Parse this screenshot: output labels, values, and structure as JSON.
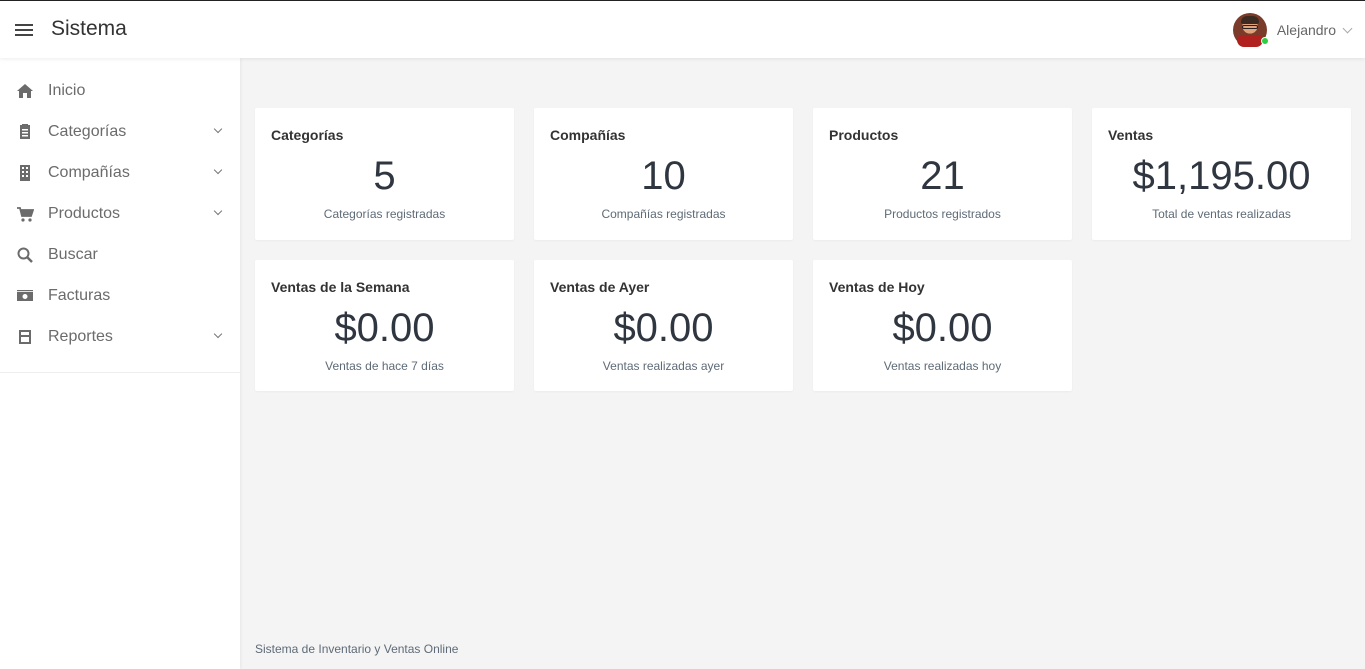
{
  "app": {
    "title": "Sistema"
  },
  "header": {
    "menu_icon": "hamburger-icon",
    "user_name": "Alejandro",
    "status_color": "#2ecc40"
  },
  "sidebar": {
    "items": [
      {
        "label": "Inicio",
        "icon": "home-icon",
        "has_submenu": false
      },
      {
        "label": "Categorías",
        "icon": "clipboard-icon",
        "has_submenu": true
      },
      {
        "label": "Compañías",
        "icon": "building-icon",
        "has_submenu": true
      },
      {
        "label": "Productos",
        "icon": "cart-icon",
        "has_submenu": true
      },
      {
        "label": "Buscar",
        "icon": "search-icon",
        "has_submenu": false
      },
      {
        "label": "Facturas",
        "icon": "money-icon",
        "has_submenu": false
      },
      {
        "label": "Reportes",
        "icon": "report-icon",
        "has_submenu": true
      }
    ]
  },
  "cards": [
    {
      "title": "Categorías",
      "value": "5",
      "subtitle": "Categorías registradas"
    },
    {
      "title": "Compañías",
      "value": "10",
      "subtitle": "Compañías registradas"
    },
    {
      "title": "Productos",
      "value": "21",
      "subtitle": "Productos registrados"
    },
    {
      "title": "Ventas",
      "value": "$1,195.00",
      "subtitle": "Total de ventas realizadas"
    },
    {
      "title": "Ventas de la Semana",
      "value": "$0.00",
      "subtitle": "Ventas de hace 7 días"
    },
    {
      "title": "Ventas de Ayer",
      "value": "$0.00",
      "subtitle": "Ventas realizadas ayer"
    },
    {
      "title": "Ventas de Hoy",
      "value": "$0.00",
      "subtitle": "Ventas realizadas hoy"
    }
  ],
  "footer": {
    "text": "Sistema de Inventario y Ventas Online"
  }
}
